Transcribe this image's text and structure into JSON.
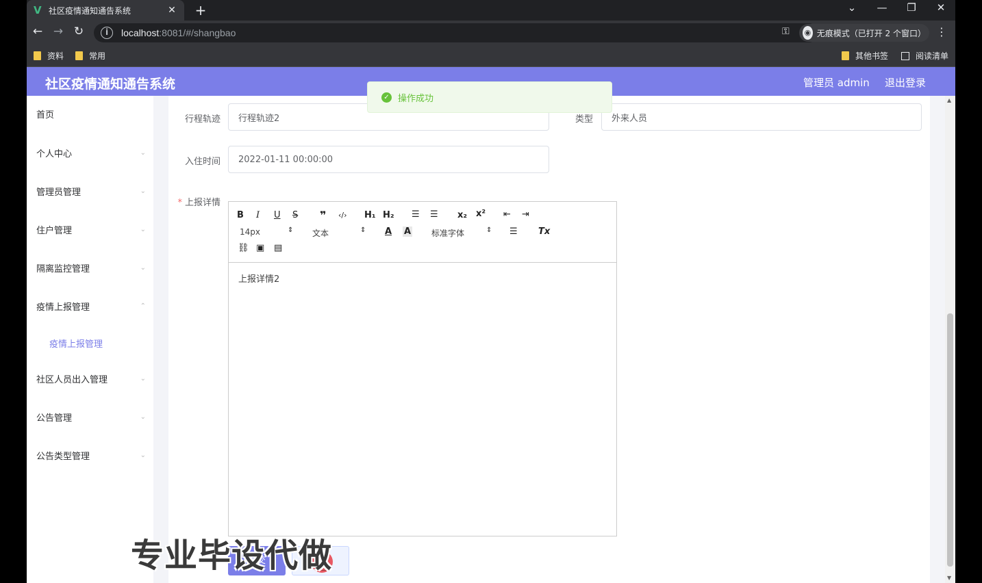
{
  "browser": {
    "tab_title": "社区疫情通知通告系统",
    "tab_favicon": "V",
    "url_host": "localhost",
    "url_rest": ":8081/#/shangbao",
    "incognito_label": "无痕模式（已打开 2 个窗口）",
    "bookmarks": [
      "资料",
      "常用"
    ],
    "bookmarks_right": [
      "其他书签",
      "阅读清单"
    ],
    "icons": [
      "back-icon",
      "forward-icon",
      "reload-icon",
      "info-icon",
      "key-icon",
      "star-icon",
      "incognito-icon",
      "menu-icon",
      "close-icon",
      "plus-icon",
      "minimize-icon",
      "restore-icon"
    ]
  },
  "app": {
    "title": "社区疫情通知通告系统",
    "user": "管理员 admin",
    "logout": "退出登录",
    "brand_color": "#7b7ee8"
  },
  "sidebar": {
    "items": [
      {
        "label": "首页"
      },
      {
        "label": "个人中心"
      },
      {
        "label": "管理员管理"
      },
      {
        "label": "住户管理"
      },
      {
        "label": "隔离监控管理"
      },
      {
        "label": "疫情上报管理"
      },
      {
        "label": "社区人员出入管理"
      },
      {
        "label": "公告管理"
      },
      {
        "label": "公告类型管理"
      }
    ],
    "sub_item": "疫情上报管理"
  },
  "form": {
    "trail_label": "行程轨迹",
    "trail_value": "行程轨迹2",
    "type_label": "类型",
    "type_value": "外来人员",
    "checkin_label": "入住时间",
    "checkin_value": "2022-01-11 00:00:00",
    "detail_label": "上报详情",
    "detail_value": "上报详情2",
    "submit_label": "提交",
    "cancel_label": "取消"
  },
  "editor": {
    "font_size": "14px",
    "header": "文本",
    "font_family": "标准字体"
  },
  "toast": {
    "message": "操作成功",
    "color": "#67c23a"
  },
  "watermark": "专业毕设代做"
}
